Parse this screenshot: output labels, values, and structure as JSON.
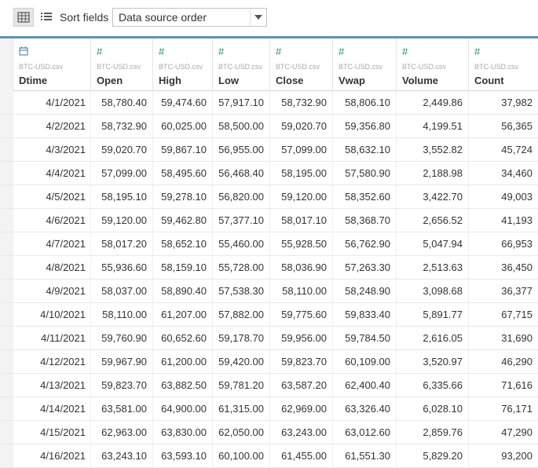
{
  "toolbar": {
    "grid_view": "grid-view-icon",
    "list_view": "list-view-icon",
    "sort_label": "Sort fields",
    "sort_value": "Data source order"
  },
  "columns": [
    {
      "type_icon": "calendar-icon",
      "source": "BTC-USD.csv",
      "name": "Dtime"
    },
    {
      "type_icon": "#",
      "source": "BTC-USD.csv",
      "name": "Open"
    },
    {
      "type_icon": "#",
      "source": "BTC-USD.csv",
      "name": "High"
    },
    {
      "type_icon": "#",
      "source": "BTC-USD.csv",
      "name": "Low"
    },
    {
      "type_icon": "#",
      "source": "BTC-USD.csv",
      "name": "Close"
    },
    {
      "type_icon": "#",
      "source": "BTC-USD.csv",
      "name": "Vwap"
    },
    {
      "type_icon": "#",
      "source": "BTC-USD.csv",
      "name": "Volume"
    },
    {
      "type_icon": "#",
      "source": "BTC-USD.csv",
      "name": "Count"
    }
  ],
  "rows": [
    [
      "4/1/2021",
      "58,780.40",
      "59,474.60",
      "57,917.10",
      "58,732.90",
      "58,806.10",
      "2,449.86",
      "37,982"
    ],
    [
      "4/2/2021",
      "58,732.90",
      "60,025.00",
      "58,500.00",
      "59,020.70",
      "59,356.80",
      "4,199.51",
      "56,365"
    ],
    [
      "4/3/2021",
      "59,020.70",
      "59,867.10",
      "56,955.00",
      "57,099.00",
      "58,632.10",
      "3,552.82",
      "45,724"
    ],
    [
      "4/4/2021",
      "57,099.00",
      "58,495.60",
      "56,468.40",
      "58,195.00",
      "57,580.90",
      "2,188.98",
      "34,460"
    ],
    [
      "4/5/2021",
      "58,195.10",
      "59,278.10",
      "56,820.00",
      "59,120.00",
      "58,352.60",
      "3,422.70",
      "49,003"
    ],
    [
      "4/6/2021",
      "59,120.00",
      "59,462.80",
      "57,377.10",
      "58,017.10",
      "58,368.70",
      "2,656.52",
      "41,193"
    ],
    [
      "4/7/2021",
      "58,017.20",
      "58,652.10",
      "55,460.00",
      "55,928.50",
      "56,762.90",
      "5,047.94",
      "66,953"
    ],
    [
      "4/8/2021",
      "55,936.60",
      "58,159.10",
      "55,728.00",
      "58,036.90",
      "57,263.30",
      "2,513.63",
      "36,450"
    ],
    [
      "4/9/2021",
      "58,037.00",
      "58,890.40",
      "57,538.30",
      "58,110.00",
      "58,248.90",
      "3,098.68",
      "36,377"
    ],
    [
      "4/10/2021",
      "58,110.00",
      "61,207.00",
      "57,882.00",
      "59,775.60",
      "59,833.40",
      "5,891.77",
      "67,715"
    ],
    [
      "4/11/2021",
      "59,760.90",
      "60,652.60",
      "59,178.70",
      "59,956.00",
      "59,784.50",
      "2,616.05",
      "31,690"
    ],
    [
      "4/12/2021",
      "59,967.90",
      "61,200.00",
      "59,420.00",
      "59,823.70",
      "60,109.00",
      "3,520.97",
      "46,290"
    ],
    [
      "4/13/2021",
      "59,823.70",
      "63,882.50",
      "59,781.20",
      "63,587.20",
      "62,400.40",
      "6,335.66",
      "71,616"
    ],
    [
      "4/14/2021",
      "63,581.00",
      "64,900.00",
      "61,315.00",
      "62,969.00",
      "63,326.40",
      "6,028.10",
      "76,171"
    ],
    [
      "4/15/2021",
      "62,963.00",
      "63,830.00",
      "62,050.00",
      "63,243.00",
      "63,012.60",
      "2,859.76",
      "47,290"
    ],
    [
      "4/16/2021",
      "63,243.10",
      "63,593.10",
      "60,100.00",
      "61,455.00",
      "61,551.30",
      "5,829.20",
      "93,200"
    ]
  ]
}
